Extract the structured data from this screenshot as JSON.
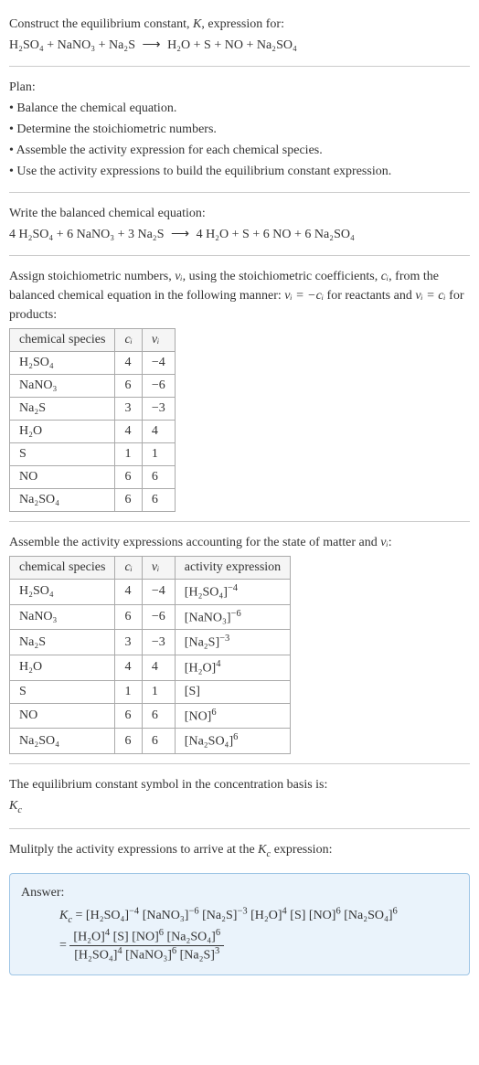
{
  "title_prefix": "Construct the equilibrium constant, ",
  "title_K": "K",
  "title_suffix": ", expression for:",
  "reaction_unbalanced": {
    "lhs": [
      "H₂SO₄",
      "NaNO₃",
      "Na₂S"
    ],
    "arrow": "⟶",
    "rhs": [
      "H₂O",
      "S",
      "NO",
      "Na₂SO₄"
    ]
  },
  "plan_label": "Plan:",
  "plan_steps": [
    "• Balance the chemical equation.",
    "• Determine the stoichiometric numbers.",
    "• Assemble the activity expression for each chemical species.",
    "• Use the activity expressions to build the equilibrium constant expression."
  ],
  "balanced_label": "Write the balanced chemical equation:",
  "reaction_balanced": {
    "lhs": [
      "4 H₂SO₄",
      "6 NaNO₃",
      "3 Na₂S"
    ],
    "arrow": "⟶",
    "rhs": [
      "4 H₂O",
      "S",
      "6 NO",
      "6 Na₂SO₄"
    ]
  },
  "stoich_intro_1": "Assign stoichiometric numbers, ",
  "stoich_nu": "νᵢ",
  "stoich_intro_2": ", using the stoichiometric coefficients, ",
  "stoich_ci": "cᵢ",
  "stoich_intro_3": ", from the balanced chemical equation in the following manner: ",
  "stoich_eq_react": "νᵢ = −cᵢ",
  "stoich_intro_4": " for reactants and ",
  "stoich_eq_prod": "νᵢ = cᵢ",
  "stoich_intro_5": " for products:",
  "table1": {
    "headers": [
      "chemical species",
      "cᵢ",
      "νᵢ"
    ],
    "rows": [
      [
        "H₂SO₄",
        "4",
        "−4"
      ],
      [
        "NaNO₃",
        "6",
        "−6"
      ],
      [
        "Na₂S",
        "3",
        "−3"
      ],
      [
        "H₂O",
        "4",
        "4"
      ],
      [
        "S",
        "1",
        "1"
      ],
      [
        "NO",
        "6",
        "6"
      ],
      [
        "Na₂SO₄",
        "6",
        "6"
      ]
    ]
  },
  "activity_intro_1": "Assemble the activity expressions accounting for the state of matter and ",
  "activity_intro_2": ":",
  "table2": {
    "headers": [
      "chemical species",
      "cᵢ",
      "νᵢ",
      "activity expression"
    ],
    "rows": [
      {
        "sp": "H₂SO₄",
        "c": "4",
        "v": "−4",
        "base": "[H₂SO₄]",
        "exp": "−4"
      },
      {
        "sp": "NaNO₃",
        "c": "6",
        "v": "−6",
        "base": "[NaNO₃]",
        "exp": "−6"
      },
      {
        "sp": "Na₂S",
        "c": "3",
        "v": "−3",
        "base": "[Na₂S]",
        "exp": "−3"
      },
      {
        "sp": "H₂O",
        "c": "4",
        "v": "4",
        "base": "[H₂O]",
        "exp": "4"
      },
      {
        "sp": "S",
        "c": "1",
        "v": "1",
        "base": "[S]",
        "exp": ""
      },
      {
        "sp": "NO",
        "c": "6",
        "v": "6",
        "base": "[NO]",
        "exp": "6"
      },
      {
        "sp": "Na₂SO₄",
        "c": "6",
        "v": "6",
        "base": "[Na₂SO₄]",
        "exp": "6"
      }
    ]
  },
  "kc_label_1": "The equilibrium constant symbol in the concentration basis is:",
  "kc_sym_base": "K",
  "kc_sym_sub": "c",
  "mul_label_1": "Mulitply the activity expressions to arrive at the ",
  "mul_label_2": " expression:",
  "answer_label": "Answer:",
  "answer": {
    "kc": "K",
    "kc_sub": "c",
    "eq": " = ",
    "line1_terms": [
      {
        "b": "[H₂SO₄]",
        "e": "−4"
      },
      {
        "b": "[NaNO₃]",
        "e": "−6"
      },
      {
        "b": "[Na₂S]",
        "e": "−3"
      },
      {
        "b": "[H₂O]",
        "e": "4"
      },
      {
        "b": "[S]",
        "e": ""
      },
      {
        "b": "[NO]",
        "e": "6"
      },
      {
        "b": "[Na₂SO₄]",
        "e": "6"
      }
    ],
    "num_terms": [
      {
        "b": "[H₂O]",
        "e": "4"
      },
      {
        "b": "[S]",
        "e": ""
      },
      {
        "b": "[NO]",
        "e": "6"
      },
      {
        "b": "[Na₂SO₄]",
        "e": "6"
      }
    ],
    "den_terms": [
      {
        "b": "[H₂SO₄]",
        "e": "4"
      },
      {
        "b": "[NaNO₃]",
        "e": "6"
      },
      {
        "b": "[Na₂S]",
        "e": "3"
      }
    ]
  }
}
